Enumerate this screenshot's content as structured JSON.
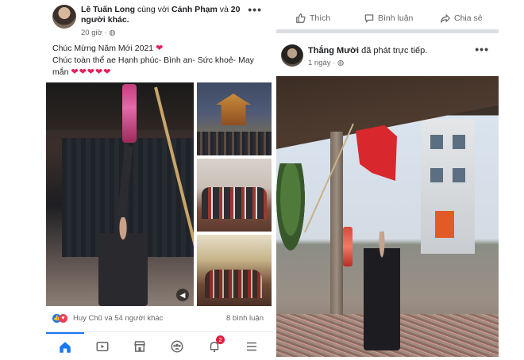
{
  "left_post": {
    "author": "Lê Tuấn Long",
    "with_text": "cùng với",
    "tagged": "Cảnh Phạm",
    "and_text": "và",
    "others": "20 người khác.",
    "time": "20 giờ ·",
    "line1": "Chúc Mừng Năm Mới 2021",
    "line2": "Chúc toàn thể ae Hạnh phúc- Bình an- Sức khoẻ- May mắn",
    "reactions_text": "Huy Chũ và 54 người khác",
    "comments_text": "8 bình luận",
    "more_glyph": "•••"
  },
  "bottom_nav": {
    "items": [
      "home-icon",
      "watch-icon",
      "marketplace-icon",
      "groups-icon",
      "notifications-icon",
      "menu-icon"
    ],
    "notification_badge": "2",
    "accent": "#1877f2"
  },
  "right_post": {
    "actions": {
      "like": "Thích",
      "comment": "Bình luận",
      "share": "Chia sẻ"
    },
    "author": "Thắng Mười",
    "action_text": "đã phát trực tiếp.",
    "time": "1 ngày ·",
    "more_glyph": "•••"
  },
  "colors": {
    "link_text": "#1c1e21",
    "secondary_text": "#65676b",
    "heart": "#e0245e",
    "badge": "#e41e3f"
  }
}
